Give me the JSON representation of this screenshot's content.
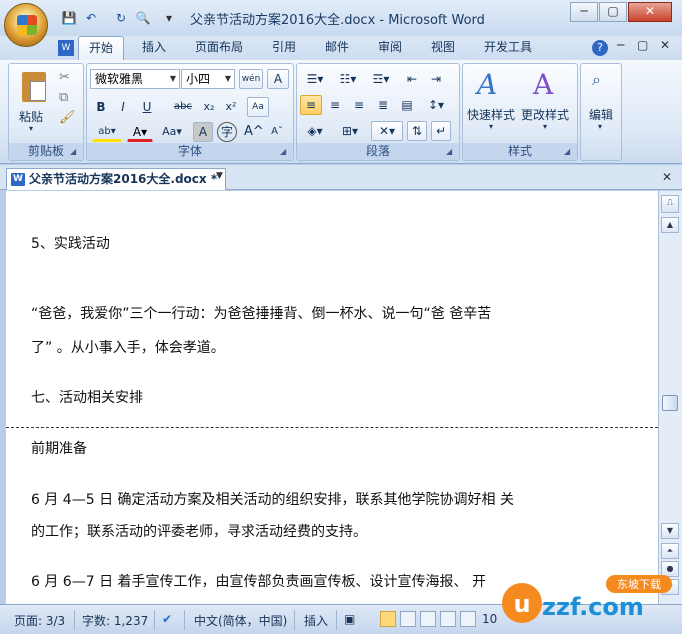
{
  "window": {
    "title": "父亲节活动方案2016大全.docx - Microsoft Word",
    "minimize": "─",
    "maximize": "▢",
    "close": "✕"
  },
  "quick_access": {
    "save": "💾",
    "undo": "↶",
    "redo": "↻",
    "print_preview": "🔍",
    "customize": "▾"
  },
  "tabs": [
    {
      "label": "开始",
      "active": true
    },
    {
      "label": "插入"
    },
    {
      "label": "页面布局"
    },
    {
      "label": "引用"
    },
    {
      "label": "邮件"
    },
    {
      "label": "审阅"
    },
    {
      "label": "视图"
    },
    {
      "label": "开发工具"
    }
  ],
  "ribbon": {
    "clipboard": {
      "label": "剪贴板",
      "paste": "粘贴"
    },
    "font": {
      "label": "字体",
      "font_name": "微软雅黑",
      "font_size": "小四",
      "bold": "B",
      "italic": "I",
      "underline": "U",
      "strike": "abc",
      "subscript": "x₂",
      "superscript": "x²",
      "text_color": "A",
      "case": "Aa",
      "grow": "A",
      "shrink": "A",
      "char_border": "A",
      "enclose": "字"
    },
    "paragraph": {
      "label": "段落"
    },
    "styles": {
      "label": "样式",
      "quick_styles": "快速样式",
      "change_styles": "更改样式"
    },
    "editing": {
      "label": "编辑",
      "edit": "编辑"
    }
  },
  "document_tab": {
    "name": "父亲节活动方案2016大全.docx *"
  },
  "document": {
    "lines": [
      "5、实践活动",
      "“爸爸，我爱你”三个一行动：为爸爸捶捶背、倒一杯水、说一句“爸 爸辛苦",
      "了” 。从小事入手，体会孝道。",
      "七、活动相关安排",
      "前期准备",
      "6 月 4—5 日 确定活动方案及相关活动的组织安排，联系其他学院协调好相 关",
      "的工作；联系活动的评委老师，寻求活动经费的支持。",
      "6 月 6—7 日 着手宣传工作，由宣传部负责画宣传板、设计宣传海报、 开"
    ]
  },
  "status": {
    "page": "页面: 3/3",
    "words": "字数: 1,237",
    "language": "中文(简体，中国)",
    "mode": "插入",
    "zoom": "10"
  },
  "watermark": {
    "text": "uzzf.com",
    "sub": "东坡下载"
  },
  "colors": {
    "accent": "#2b579a",
    "ribbon_bg": "#dde8f6",
    "highlight": "#ffe000",
    "font_red": "#e02020"
  }
}
